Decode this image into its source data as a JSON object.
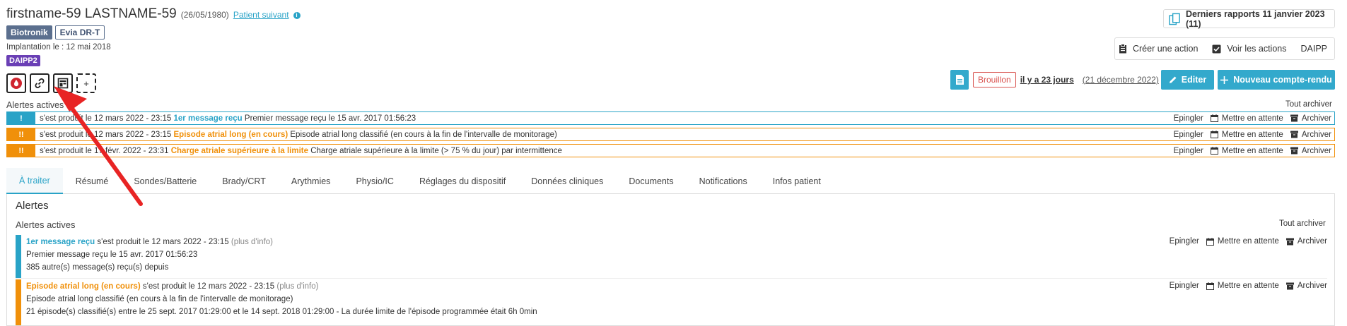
{
  "patient": {
    "name": "firstname-59 LASTNAME-59",
    "dob": "(26/05/1980)",
    "next_link": "Patient suivant",
    "brand": "Biotronik",
    "model": "Evia DR-T",
    "implant_label": "Implantation le : 12 mai 2018",
    "program_badge": "DAIPP2"
  },
  "header": {
    "reports_label": "Derniers rapports 11 janvier 2023 (11)",
    "create_action": "Créer une action",
    "view_actions": "Voir les actions",
    "daipp": "DAIPP",
    "draft_badge": "Brouillon",
    "ago": "il y a 23 jours",
    "draft_date": "(21 décembre 2022)",
    "edit_label": "Editer",
    "new_report_label": "Nouveau compte-rendu"
  },
  "alerts_bar": {
    "title": "Alertes actives",
    "archive_all": "Tout archiver",
    "pin": "Epingler",
    "wait": "Mettre en attente",
    "archive": "Archiver",
    "items": [
      {
        "severity": "!",
        "when": "s'est produit le 12 mars 2022 - 23:15",
        "title": "1er message reçu",
        "detail": "Premier message reçu le 15 avr. 2017 01:56:23",
        "color": "#29a3c7"
      },
      {
        "severity": "!!",
        "when": "s'est produit le 12 mars 2022 - 23:15",
        "title": "Episode atrial long (en cours)",
        "detail": "Episode atrial long classifié (en cours à la fin de l'intervalle de monitorage)",
        "color": "#f0900a"
      },
      {
        "severity": "!!",
        "when": "s'est produit le 17 févr. 2022 - 23:31",
        "title": "Charge atriale supérieure à la limite",
        "detail": "Charge atriale supérieure à la limite (> 75 % du jour) par intermittence",
        "color": "#f0900a"
      }
    ]
  },
  "tabs": [
    "À traiter",
    "Résumé",
    "Sondes/Batterie",
    "Brady/CRT",
    "Arythmies",
    "Physio/IC",
    "Réglages du dispositif",
    "Données cliniques",
    "Documents",
    "Notifications",
    "Infos patient"
  ],
  "panel": {
    "title": "Alertes",
    "subtitle": "Alertes actives",
    "archive_all": "Tout archiver",
    "cards": [
      {
        "title": "1er message reçu",
        "when": "s'est produit le 12 mars 2022 - 23:15",
        "more": "(plus d'info)",
        "line2": "Premier message reçu le 15 avr. 2017 01:56:23",
        "line3": "385 autre(s) message(s) reçu(s) depuis",
        "color": "#29a3c7"
      },
      {
        "title": "Episode atrial long (en cours)",
        "when": "s'est produit le 12 mars 2022 - 23:15",
        "more": "(plus d'info)",
        "line2": "Episode atrial long classifié (en cours à la fin de l'intervalle de monitorage)",
        "line3": "21 épisode(s) classifié(s) entre le 25 sept. 2017 01:29:00 et le 14 sept. 2018 01:29:00 - La durée limite de l'épisode programmée était 6h 0min",
        "color": "#f0900a"
      }
    ]
  }
}
